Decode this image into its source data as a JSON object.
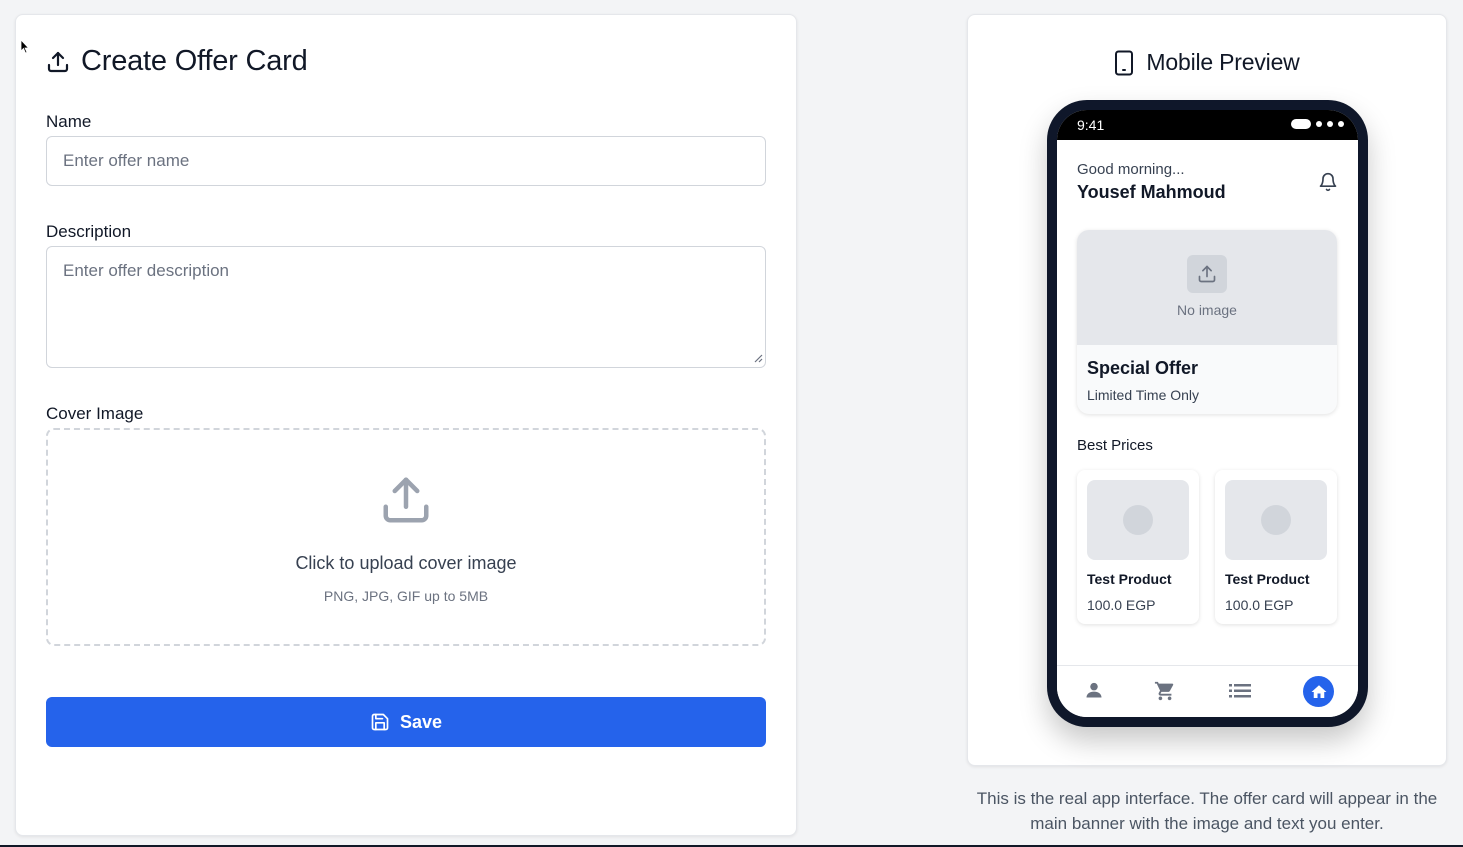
{
  "form": {
    "title": "Create Offer Card",
    "name_label": "Name",
    "name_placeholder": "Enter offer name",
    "name_value": "",
    "description_label": "Description",
    "description_placeholder": "Enter offer description",
    "description_value": "",
    "cover_label": "Cover Image",
    "upload_title": "Click to upload cover image",
    "upload_hint": "PNG, JPG, GIF up to 5MB",
    "save_label": "Save",
    "accent_color": "#2563eb"
  },
  "preview": {
    "title": "Mobile Preview",
    "note": "This is the real app interface. The offer card will appear in the main banner with the image and text you enter.",
    "phone": {
      "time": "9:41",
      "greeting": "Good morning...",
      "user_name": "Yousef Mahmoud",
      "offer": {
        "no_image_text": "No image",
        "title": "Special Offer",
        "subtitle": "Limited Time Only"
      },
      "section_title": "Best Prices",
      "products": [
        {
          "name": "Test Product",
          "price": "100.0 EGP"
        },
        {
          "name": "Test Product",
          "price": "100.0 EGP"
        }
      ],
      "nav": {
        "items": [
          "profile-icon",
          "cart-icon",
          "list-icon",
          "home-icon"
        ],
        "active": "home-icon"
      }
    }
  }
}
